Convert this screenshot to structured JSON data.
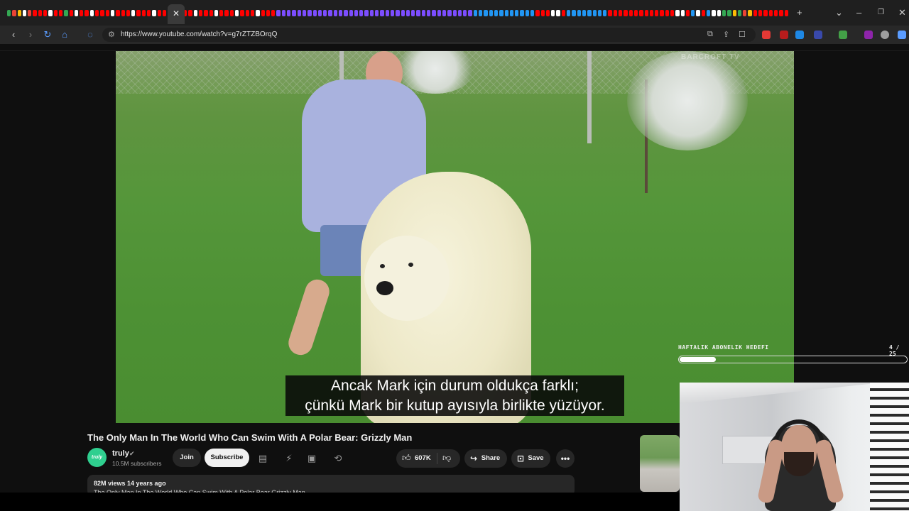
{
  "browser": {
    "url": "https://www.youtube.com/watch?v=g7rZTZBOrqQ",
    "new_tab_label": "+",
    "active_tab_close": "✕",
    "tab_favicon_colors": [
      "#34a853",
      "#ea4335",
      "#fbbc05",
      "#ffffff",
      "#ea4335",
      "#ff0000",
      "#ff0000",
      "#ff0000",
      "#ffffff",
      "#ff0000",
      "#ff0000",
      "#34a853",
      "#ff0000",
      "#ffffff",
      "#ff0000",
      "#ff0000",
      "#ffffff",
      "#ff0000",
      "#ff0000",
      "#ff0000",
      "#ffffff",
      "#ff0000",
      "#ff0000",
      "#ff0000",
      "#ffffff",
      "#ff0000",
      "#ff0000",
      "#ff0000",
      "#ffffff",
      "#ff0000",
      "#ff0000",
      "#ff0000",
      "#ffffff",
      "#ff0000",
      "#ff0000",
      "#ff0000",
      "#ffffff",
      "#ff0000",
      "#ff0000",
      "#ff0000",
      "#ffffff",
      "#ff0000",
      "#ff0000",
      "#ff0000",
      "#ffffff",
      "#ff0000",
      "#ff0000",
      "#ff0000",
      "#ffffff",
      "#ff0000",
      "#ff0000",
      "#ff0000",
      "#7c4dff",
      "#7c4dff",
      "#7c4dff",
      "#7c4dff",
      "#7c4dff",
      "#7c4dff",
      "#7c4dff",
      "#7c4dff",
      "#7c4dff",
      "#7c4dff",
      "#7c4dff",
      "#7c4dff",
      "#7c4dff",
      "#7c4dff",
      "#7c4dff",
      "#7c4dff",
      "#7c4dff",
      "#7c4dff",
      "#7c4dff",
      "#7c4dff",
      "#7c4dff",
      "#7c4dff",
      "#7c4dff",
      "#7c4dff",
      "#7c4dff",
      "#7c4dff",
      "#7c4dff",
      "#7c4dff",
      "#7c4dff",
      "#7c4dff",
      "#7c4dff",
      "#7c4dff",
      "#7c4dff",
      "#7c4dff",
      "#7c4dff",
      "#7c4dff",
      "#7c4dff",
      "#7c4dff",
      "#2196f3",
      "#2196f3",
      "#2196f3",
      "#2196f3",
      "#2196f3",
      "#2196f3",
      "#2196f3",
      "#2196f3",
      "#2196f3",
      "#2196f3",
      "#2196f3",
      "#2196f3",
      "#ff0000",
      "#ff0000",
      "#ff0000",
      "#ffffff",
      "#ffffff",
      "#ff0000",
      "#2196f3",
      "#2196f3",
      "#2196f3",
      "#2196f3",
      "#2196f3",
      "#2196f3",
      "#2196f3",
      "#2196f3",
      "#ff0000",
      "#ff0000",
      "#ff0000",
      "#ff0000",
      "#ff0000",
      "#ff0000",
      "#ff0000",
      "#ff0000",
      "#ff0000",
      "#ff0000",
      "#ff0000",
      "#ff0000",
      "#ff0000",
      "#ffffff",
      "#ffffff",
      "#ff0000",
      "#2196f3",
      "#ffffff",
      "#ff0000",
      "#2196f3",
      "#ffffff",
      "#ffffff",
      "#34a853",
      "#34a853",
      "#fbbc05",
      "#34a853",
      "#ea4335",
      "#fbbc05",
      "#ff0000",
      "#ff0000",
      "#ff0000",
      "#ff0000",
      "#ff0000",
      "#ff0000",
      "#ff0000"
    ]
  },
  "toolbar": {
    "back_icon": "‹",
    "forward_icon": "›",
    "reload_icon": "↻",
    "home_icon": "⌂"
  },
  "overlay": {
    "goal_label": "HAFTALIK ABONELIK HEDEFI",
    "goal_count": "4 / 25",
    "goal_current": 4,
    "goal_target": 25
  },
  "video": {
    "watermark": "BARCROFT TV",
    "subtitle_line1": "Ancak Mark için durum oldukça farklı;",
    "subtitle_line2": "çünkü Mark bir kutup ayısıyla birlikte yüzüyor."
  },
  "info": {
    "title": "The Only Man In The World Who Can Swim With A Polar Bear: Grizzly Man",
    "channel_avatar_text": "truly",
    "channel_name": "truly",
    "verified_icon": "✔",
    "subscribers": "10.5M subscribers",
    "join_label": "Join",
    "subscribe_label": "Subscribe",
    "like_count": "607K",
    "share_label": "Share",
    "save_label": "Save",
    "more_label": "•••",
    "views_date": "82M views  14 years ago",
    "desc_preview": "The Only Man In The World Who Can Swim With A Polar Bear Grizzly Man"
  }
}
